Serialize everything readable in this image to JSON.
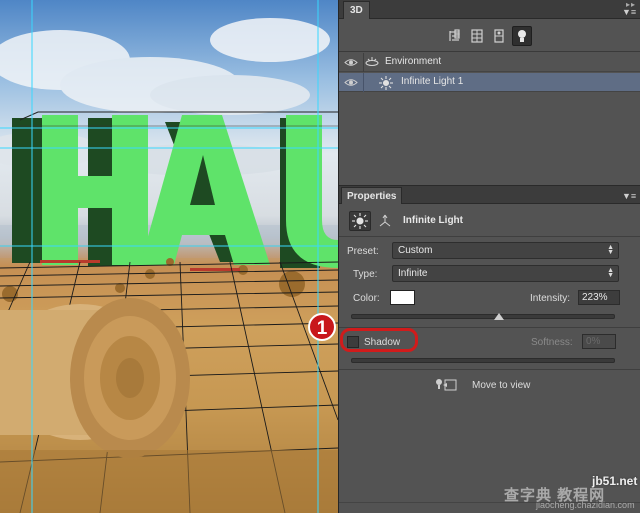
{
  "scene": {
    "text": "HAU"
  },
  "panel3d": {
    "tab_label": "3D",
    "toolbar_icons": [
      "scene-filter-icon",
      "mesh-filter-icon",
      "material-filter-icon",
      "light-filter-icon"
    ],
    "layers": [
      {
        "label": "Environment",
        "icon": "environment-icon",
        "selected": false
      },
      {
        "label": "Infinite Light 1",
        "icon": "infinite-light-icon",
        "selected": true
      }
    ]
  },
  "properties": {
    "tab_label": "Properties",
    "header_title": "Infinite Light",
    "preset_label": "Preset:",
    "preset_value": "Custom",
    "type_label": "Type:",
    "type_value": "Infinite",
    "color_label": "Color:",
    "color_value": "#ffffff",
    "intensity_label": "Intensity:",
    "intensity_value": "223%",
    "intensity_level": 0.56,
    "shadow_label": "Shadow",
    "shadow_checked": false,
    "softness_label": "Softness:",
    "softness_value": "0%",
    "move_to_view_label": "Move to view"
  },
  "callout": {
    "number": "1"
  },
  "watermark": {
    "site": "jb51.net",
    "line1": "查字典 教程网",
    "line2": "jiaocheng.chazidian.com"
  },
  "colors": {
    "letters": "#5fe36a",
    "callout": "#d11b1b",
    "selected_row": "#5f6d85"
  }
}
